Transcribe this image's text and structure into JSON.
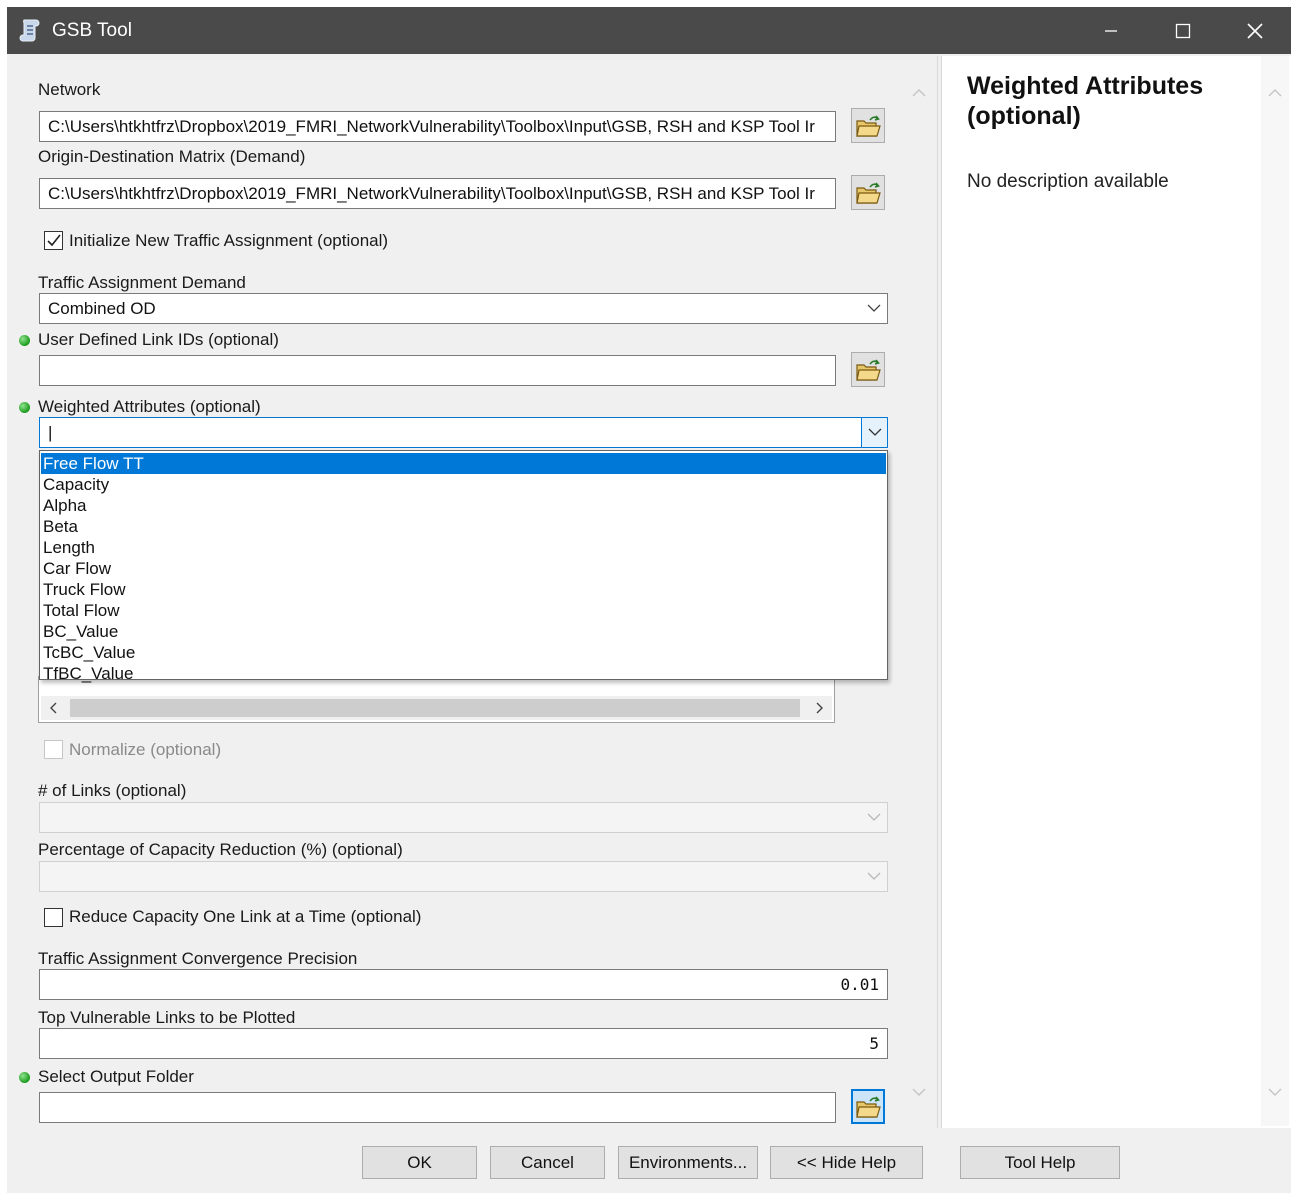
{
  "window": {
    "title": "GSB Tool",
    "icon": "tool-script-icon",
    "controls": [
      "minimize-icon",
      "maximize-icon",
      "close-icon"
    ]
  },
  "form": {
    "network": {
      "label": "Network",
      "value": "C:\\Users\\htkhtfrz\\Dropbox\\2019_FMRI_NetworkVulnerability\\Toolbox\\Input\\GSB, RSH and KSP Tool Ir"
    },
    "od_matrix": {
      "label": "Origin-Destination Matrix (Demand)",
      "value": "C:\\Users\\htkhtfrz\\Dropbox\\2019_FMRI_NetworkVulnerability\\Toolbox\\Input\\GSB, RSH and KSP Tool Ir"
    },
    "init_assignment": {
      "label": "Initialize New Traffic Assignment (optional)",
      "checked": true
    },
    "traffic_demand": {
      "label": "Traffic Assignment Demand",
      "value": "Combined OD"
    },
    "link_ids": {
      "label": "User Defined Link IDs (optional)",
      "value": ""
    },
    "weighted_attributes": {
      "label": "Weighted Attributes (optional)",
      "value": "|",
      "options": [
        "Free Flow TT",
        "Capacity",
        "Alpha",
        "Beta",
        "Length",
        "Car Flow",
        "Truck Flow",
        "Total Flow",
        "BC_Value",
        "TcBC_Value",
        "TfBC_Value"
      ],
      "selected_index": 0
    },
    "normalize": {
      "label": "Normalize (optional)",
      "checked": false,
      "enabled": false
    },
    "num_links": {
      "label": "# of Links (optional)",
      "value": ""
    },
    "capacity_reduction": {
      "label": "Percentage of Capacity Reduction (%) (optional)",
      "value": ""
    },
    "reduce_one_link": {
      "label": "Reduce Capacity One Link at a Time (optional)",
      "checked": false
    },
    "convergence": {
      "label": "Traffic Assignment Convergence Precision",
      "value": "0.01"
    },
    "top_links": {
      "label": "Top Vulnerable Links to be Plotted",
      "value": "5"
    },
    "output_folder": {
      "label": "Select Output Folder",
      "value": ""
    }
  },
  "help": {
    "title": "Weighted Attributes (optional)",
    "description": "No description available"
  },
  "buttons": {
    "ok": "OK",
    "cancel": "Cancel",
    "environments": "Environments...",
    "hide_help": "<< Hide Help",
    "tool_help": "Tool Help"
  },
  "colors": {
    "titlebar": "#4a4a4a",
    "selection": "#0078d7",
    "required_dot": "#1a9a1a"
  }
}
